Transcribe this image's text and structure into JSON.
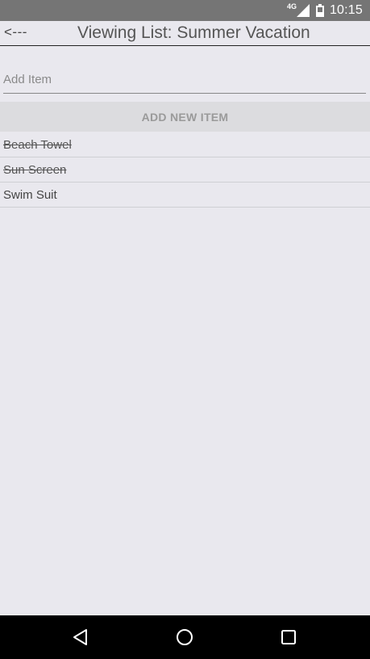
{
  "status_bar": {
    "network": "4G",
    "time": "10:15",
    "signal_icon": "cell-signal-icon",
    "battery_icon": "battery-icon"
  },
  "toolbar": {
    "back_label": "<---",
    "title": "Viewing List: Summer Vacation"
  },
  "add_item": {
    "placeholder": "Add Item",
    "value": ""
  },
  "add_button": {
    "label": "ADD NEW ITEM"
  },
  "items": [
    {
      "label": "Beach Towel",
      "checked": true
    },
    {
      "label": "Sun Screen",
      "checked": true
    },
    {
      "label": "Swim Suit",
      "checked": false
    }
  ],
  "nav_bar": {
    "back_icon": "nav-back-icon",
    "home_icon": "nav-home-icon",
    "recents_icon": "nav-recents-icon"
  },
  "colors": {
    "background": "#e9e8ee",
    "status_bar": "#757575",
    "button_bg": "#dcdcdf",
    "button_text": "#9a9a9a",
    "nav_bar": "#000000"
  }
}
